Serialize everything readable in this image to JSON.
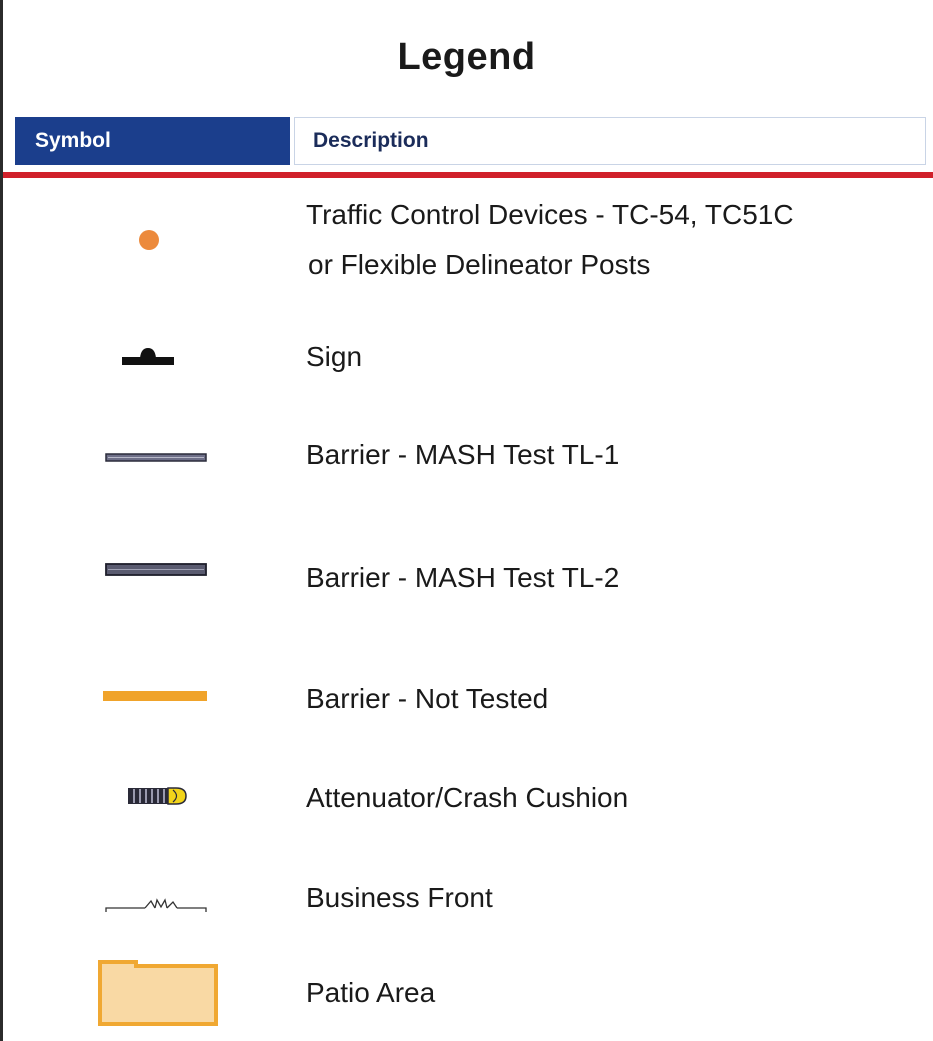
{
  "title": "Legend",
  "header": {
    "symbol_label": "Symbol",
    "description_label": "Description"
  },
  "colors": {
    "header_blue": "#1b3e8c",
    "rule_red": "#d0202a",
    "device_orange": "#ec8a3c",
    "barrier_orange": "#f0a32a",
    "patio_fill": "#f9d9a4",
    "patio_border": "#f0a832",
    "attenuator_yellow": "#f2d41a"
  },
  "legend": [
    {
      "icon": "traffic-control-device-icon",
      "line1": "Traffic Control Devices - TC-54, TC51C",
      "line2": "or Flexible Delineator Posts"
    },
    {
      "icon": "sign-icon",
      "description": "Sign"
    },
    {
      "icon": "barrier-tl1-icon",
      "description": "Barrier - MASH Test TL-1"
    },
    {
      "icon": "barrier-tl2-icon",
      "description": "Barrier - MASH Test TL-2"
    },
    {
      "icon": "barrier-not-tested-icon",
      "description": "Barrier - Not Tested"
    },
    {
      "icon": "attenuator-icon",
      "description": "Attenuator/Crash Cushion"
    },
    {
      "icon": "business-front-icon",
      "description": "Business Front"
    },
    {
      "icon": "patio-area-icon",
      "description": "Patio Area"
    }
  ]
}
